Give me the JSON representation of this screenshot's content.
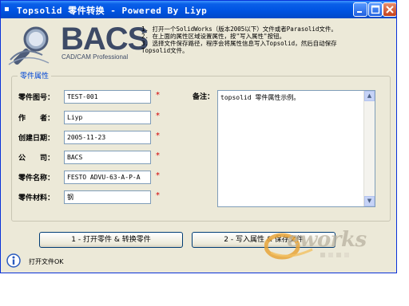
{
  "window": {
    "title": "Topsolid 零件转换 - Powered By Liyp",
    "controls": {
      "minimize": "minimize-icon",
      "maximize": "maximize-icon",
      "close": "close-icon"
    }
  },
  "logo": {
    "brand": "BACS",
    "tagline": "CAD/CAM Professional",
    "icon": "magnifier-logo-icon"
  },
  "instructions": [
    "1. 打开一个SolidWorks（版本2005以下）文件或者Parasolid文件。",
    "2. 在上面的属性区域设置属性，按\"写入属性\"按钮。",
    "3. 选择文件保存路径，程序会将属性信息写入Topsolid，然后自动保存",
    "Topsolid文件。"
  ],
  "group": {
    "legend": "零件属性"
  },
  "fields": [
    {
      "label": "零件图号：",
      "value": "TEST-001",
      "required": "*"
    },
    {
      "label": "作　　者：",
      "value": "Liyp",
      "required": "*"
    },
    {
      "label": "创建日期：",
      "value": "2005-11-23",
      "required": "*"
    },
    {
      "label": "公　　司：",
      "value": "BACS",
      "required": "*"
    },
    {
      "label": "零件名称：",
      "value": "FESTO  ADVU-63-A-P-A",
      "required": "*"
    },
    {
      "label": "零件材料：",
      "value": "钢",
      "required": "*"
    }
  ],
  "remark": {
    "label": "备注：",
    "value": "topsolid 零件属性示例。"
  },
  "buttons": {
    "open_convert": "1 - 打开零件 & 转换零件",
    "write_save": "2 - 写入属性 & 保存文件"
  },
  "status": {
    "icon": "info-icon",
    "text": "打开文件OK"
  },
  "watermark": {
    "text": "eworks"
  },
  "colors": {
    "title_bar": "#0054e3",
    "window_bg": "#ece9d8",
    "required_mark": "#d40000",
    "group_legend": "#0046d5"
  }
}
